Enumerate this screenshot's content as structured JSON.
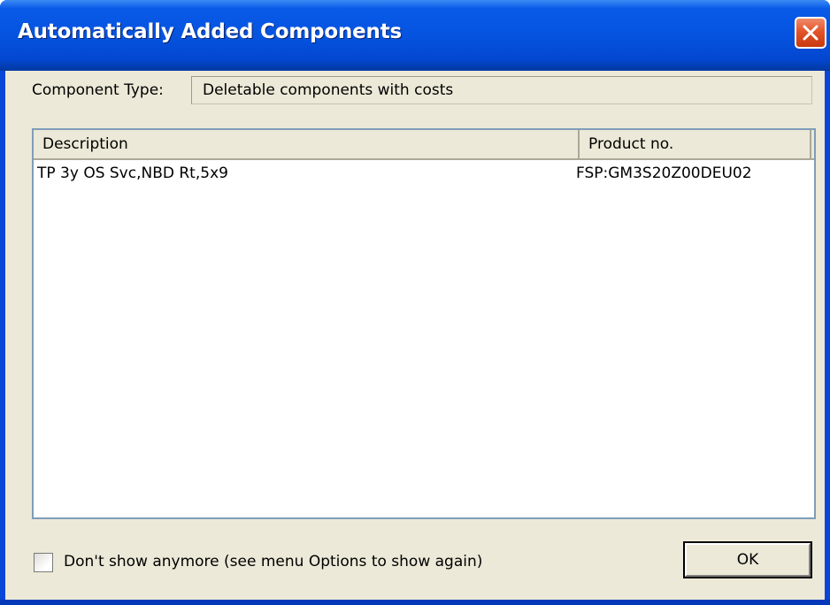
{
  "window": {
    "title": "Automatically Added Components",
    "close_icon": "close-icon",
    "colors": {
      "titlebar": "#0554e0",
      "close": "#e3542a",
      "client": "#ece9d8"
    }
  },
  "component_type": {
    "label": "Component Type:",
    "value": "Deletable components with costs"
  },
  "table": {
    "columns": [
      "Description",
      "Product no."
    ],
    "rows": [
      {
        "description": "TP 3y OS Svc,NBD Rt,5x9",
        "product_no": "FSP:GM3S20Z00DEU02"
      }
    ]
  },
  "footer": {
    "checkbox_label": "Don't show anymore (see menu Options to show again)",
    "checkbox_checked": false,
    "ok_label": "OK"
  }
}
